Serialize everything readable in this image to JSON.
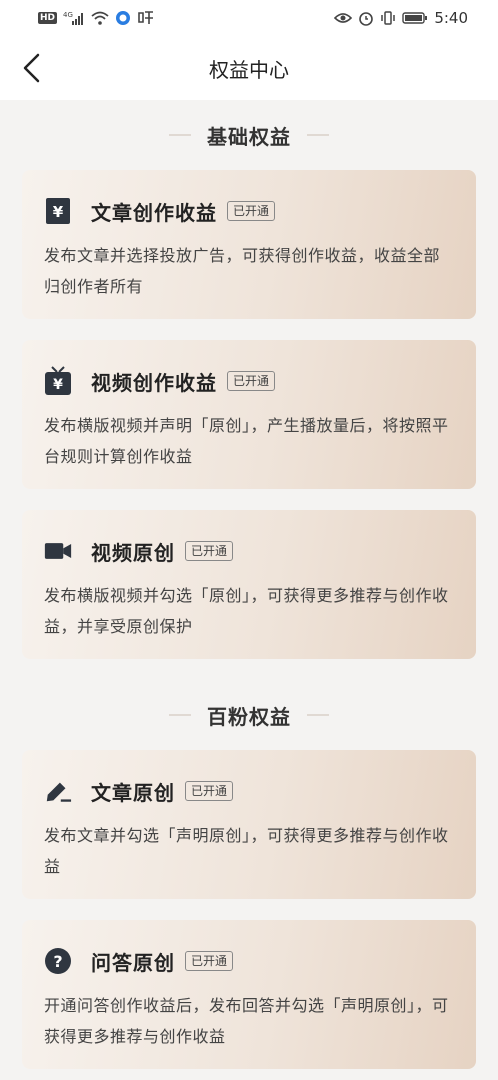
{
  "status_bar": {
    "carrier_badge": "HD",
    "network": "4G",
    "time": "5:40"
  },
  "nav": {
    "title": "权益中心"
  },
  "sections": [
    {
      "title": "基础权益",
      "cards": [
        {
          "icon": "yen-note-icon",
          "title": "文章创作收益",
          "badge": "已开通",
          "desc": "发布文章并选择投放广告，可获得创作收益，收益全部归创作者所有"
        },
        {
          "icon": "tv-yen-icon",
          "title": "视频创作收益",
          "badge": "已开通",
          "desc": "发布横版视频并声明「原创」，产生播放量后，将按照平台规则计算创作收益"
        },
        {
          "icon": "video-camera-icon",
          "title": "视频原创",
          "badge": "已开通",
          "desc": "发布横版视频并勾选「原创」，可获得更多推荐与创作收益，并享受原创保护"
        }
      ]
    },
    {
      "title": "百粉权益",
      "cards": [
        {
          "icon": "pen-icon",
          "title": "文章原创",
          "badge": "已开通",
          "desc": "发布文章并勾选「声明原创」，可获得更多推荐与创作收益"
        },
        {
          "icon": "question-icon",
          "title": "问答原创",
          "badge": "已开通",
          "desc": "开通问答创作收益后，发布回答并勾选「声明原创」，可获得更多推荐与创作收益"
        }
      ]
    }
  ]
}
